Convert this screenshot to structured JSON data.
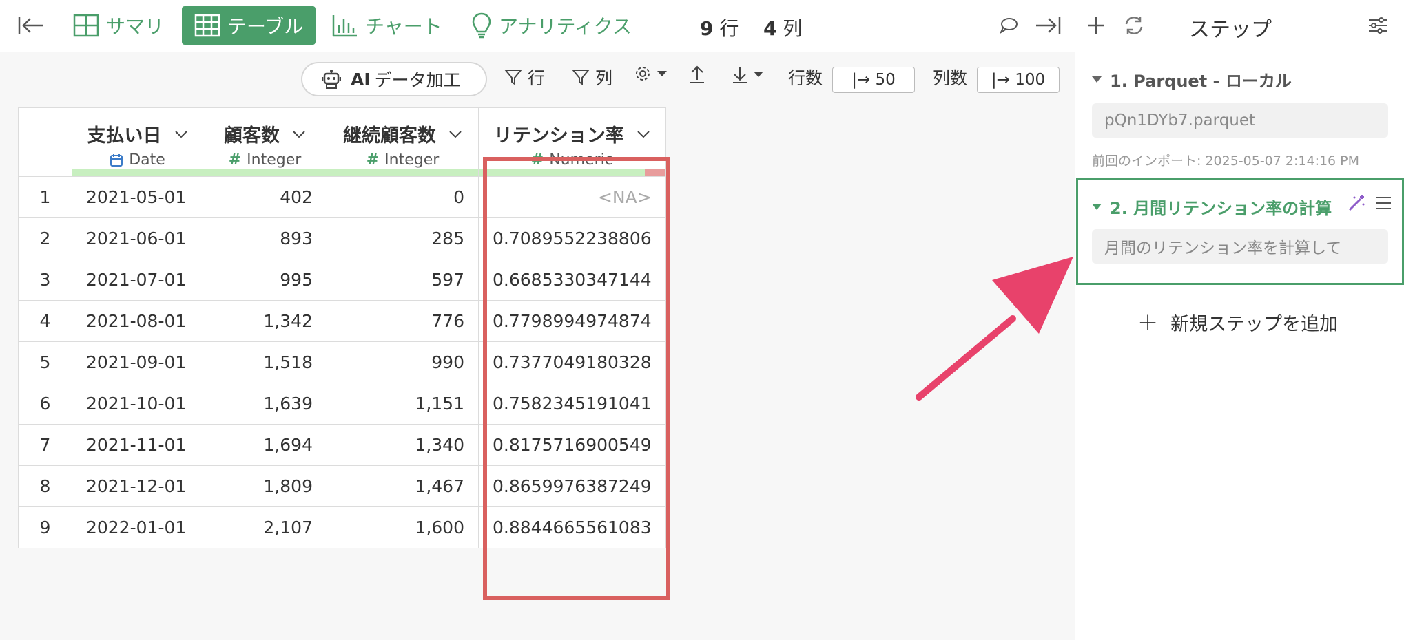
{
  "toolbar": {
    "summary": "サマリ",
    "table": "テーブル",
    "chart": "チャート",
    "analytics": "アナリティクス",
    "row_count": "9",
    "row_unit": "行",
    "col_count": "4",
    "col_unit": "列"
  },
  "subbar": {
    "ai_prefix": "AI",
    "ai_label": "データ加工",
    "filter_rows": "行",
    "filter_cols": "列",
    "rows_label": "行数",
    "rows_value": "|→ 50",
    "cols_label": "列数",
    "cols_value": "|→ 100"
  },
  "columns": [
    {
      "name": "支払い日",
      "type": "Date"
    },
    {
      "name": "顧客数",
      "type": "Integer"
    },
    {
      "name": "継続顧客数",
      "type": "Integer"
    },
    {
      "name": "リテンション率",
      "type": "Numeric"
    }
  ],
  "rows": [
    [
      "1",
      "2021-05-01",
      "402",
      "0",
      "<NA>"
    ],
    [
      "2",
      "2021-06-01",
      "893",
      "285",
      "0.7089552238806"
    ],
    [
      "3",
      "2021-07-01",
      "995",
      "597",
      "0.6685330347144"
    ],
    [
      "4",
      "2021-08-01",
      "1,342",
      "776",
      "0.7798994974874"
    ],
    [
      "5",
      "2021-09-01",
      "1,518",
      "990",
      "0.7377049180328"
    ],
    [
      "6",
      "2021-10-01",
      "1,639",
      "1,151",
      "0.7582345191041"
    ],
    [
      "7",
      "2021-11-01",
      "1,694",
      "1,340",
      "0.8175716900549"
    ],
    [
      "8",
      "2021-12-01",
      "1,809",
      "1,467",
      "0.8659976387249"
    ],
    [
      "9",
      "2022-01-01",
      "2,107",
      "1,600",
      "0.8844665561083"
    ]
  ],
  "panel": {
    "title": "ステップ",
    "step1_title": "1. Parquet - ローカル",
    "step1_file": "pQn1DYb7.parquet",
    "step1_meta": "前回のインポート: 2025-05-07 2:14:16 PM",
    "step2_title": "2. 月間リテンション率の計算",
    "step2_prompt": "月間のリテンション率を計算して",
    "add_step": "新規ステップを追加"
  },
  "colors": {
    "accent": "#4a9e6a",
    "highlight": "#d9605f",
    "arrow": "#e8426b",
    "magic": "#8e5cc9"
  }
}
